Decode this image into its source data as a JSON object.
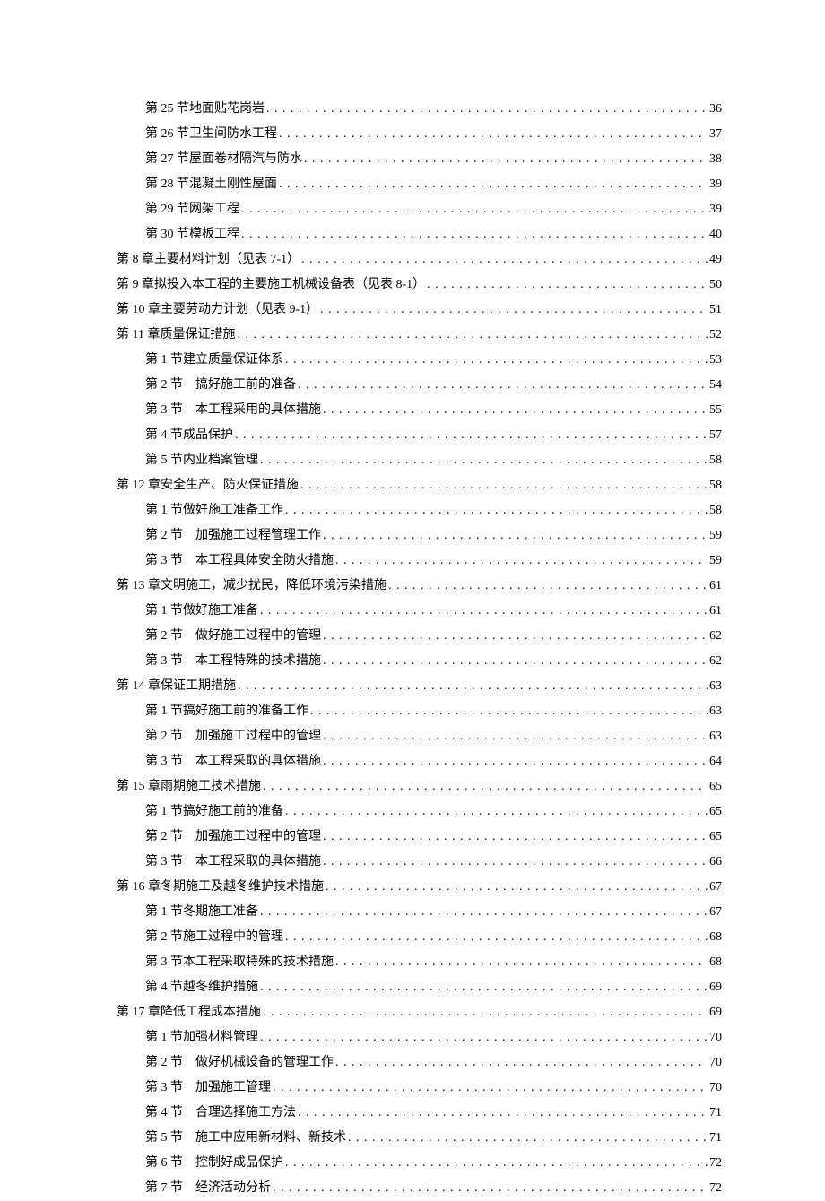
{
  "toc": [
    {
      "level": 2,
      "label": "第 25 节地面贴花岗岩",
      "page": "36"
    },
    {
      "level": 2,
      "label": "第 26 节卫生间防水工程",
      "page": "37"
    },
    {
      "level": 2,
      "label": "第 27 节屋面卷材隔汽与防水",
      "page": "38"
    },
    {
      "level": 2,
      "label": "第 28 节混凝土刚性屋面",
      "page": "39"
    },
    {
      "level": 2,
      "label": "第 29 节网架工程",
      "page": "39"
    },
    {
      "level": 2,
      "label": "第 30 节模板工程",
      "page": "40"
    },
    {
      "level": 1,
      "label": "第 8 章主要材料计划（见表 7-1）",
      "page": "49"
    },
    {
      "level": 1,
      "label": "第 9 章拟投入本工程的主要施工机械设备表（见表 8-1）",
      "page": "50"
    },
    {
      "level": 1,
      "label": "第 10 章主要劳动力计划（见表 9-1）",
      "page": "51"
    },
    {
      "level": 1,
      "label": "第 11 章质量保证措施",
      "page": "52"
    },
    {
      "level": 2,
      "label": "第 1 节建立质量保证体系",
      "page": "53"
    },
    {
      "level": 2,
      "label": "第 2 节　搞好施工前的准备",
      "page": "54"
    },
    {
      "level": 2,
      "label": "第 3 节　本工程采用的具体措施",
      "page": "55"
    },
    {
      "level": 2,
      "label": "第 4 节成品保护",
      "page": "57"
    },
    {
      "level": 2,
      "label": "第 5 节内业档案管理",
      "page": "58"
    },
    {
      "level": 1,
      "label": "第 12 章安全生产、防火保证措施",
      "page": "58"
    },
    {
      "level": 2,
      "label": "第 1 节做好施工准备工作",
      "page": "58"
    },
    {
      "level": 2,
      "label": "第 2 节　加强施工过程管理工作",
      "page": "59"
    },
    {
      "level": 2,
      "label": "第 3 节　本工程具体安全防火措施",
      "page": "59"
    },
    {
      "level": 1,
      "label": "第 13 章文明施工，减少扰民，降低环境污染措施",
      "page": "61"
    },
    {
      "level": 2,
      "label": "第 1 节做好施工准备",
      "page": "61"
    },
    {
      "level": 2,
      "label": "第 2 节　做好施工过程中的管理",
      "page": "62"
    },
    {
      "level": 2,
      "label": "第 3 节　本工程特殊的技术措施",
      "page": "62"
    },
    {
      "level": 1,
      "label": "第 14 章保证工期措施",
      "page": "63"
    },
    {
      "level": 2,
      "label": "第 1 节搞好施工前的准备工作",
      "page": "63"
    },
    {
      "level": 2,
      "label": "第 2 节　加强施工过程中的管理",
      "page": "63"
    },
    {
      "level": 2,
      "label": "第 3 节　本工程采取的具体措施",
      "page": "64"
    },
    {
      "level": 1,
      "label": "第 15 章雨期施工技术措施",
      "page": "65"
    },
    {
      "level": 2,
      "label": "第 1 节搞好施工前的准备",
      "page": "65"
    },
    {
      "level": 2,
      "label": "第 2 节　加强施工过程中的管理",
      "page": "65"
    },
    {
      "level": 2,
      "label": "第 3 节　本工程采取的具体措施",
      "page": "66"
    },
    {
      "level": 1,
      "label": "第 16 章冬期施工及越冬维护技术措施",
      "page": "67"
    },
    {
      "level": 2,
      "label": "第 1 节冬期施工准备",
      "page": "67"
    },
    {
      "level": 2,
      "label": "第 2 节施工过程中的管理",
      "page": "68"
    },
    {
      "level": 2,
      "label": "第 3 节本工程采取特殊的技术措施",
      "page": "68"
    },
    {
      "level": 2,
      "label": "第 4 节越冬维护措施",
      "page": "69"
    },
    {
      "level": 1,
      "label": "第 17 章降低工程成本措施",
      "page": "69"
    },
    {
      "level": 2,
      "label": "第 1 节加强材料管理",
      "page": "70"
    },
    {
      "level": 2,
      "label": "第 2 节　做好机械设备的管理工作",
      "page": "70"
    },
    {
      "level": 2,
      "label": "第 3 节　加强施工管理",
      "page": "70"
    },
    {
      "level": 2,
      "label": "第 4 节　合理选择施工方法",
      "page": "71"
    },
    {
      "level": 2,
      "label": "第 5 节　施工中应用新材料、新技术",
      "page": "71"
    },
    {
      "level": 2,
      "label": "第 6 节　控制好成品保护",
      "page": "72"
    },
    {
      "level": 2,
      "label": "第 7 节　经济活动分析",
      "page": "72"
    }
  ]
}
